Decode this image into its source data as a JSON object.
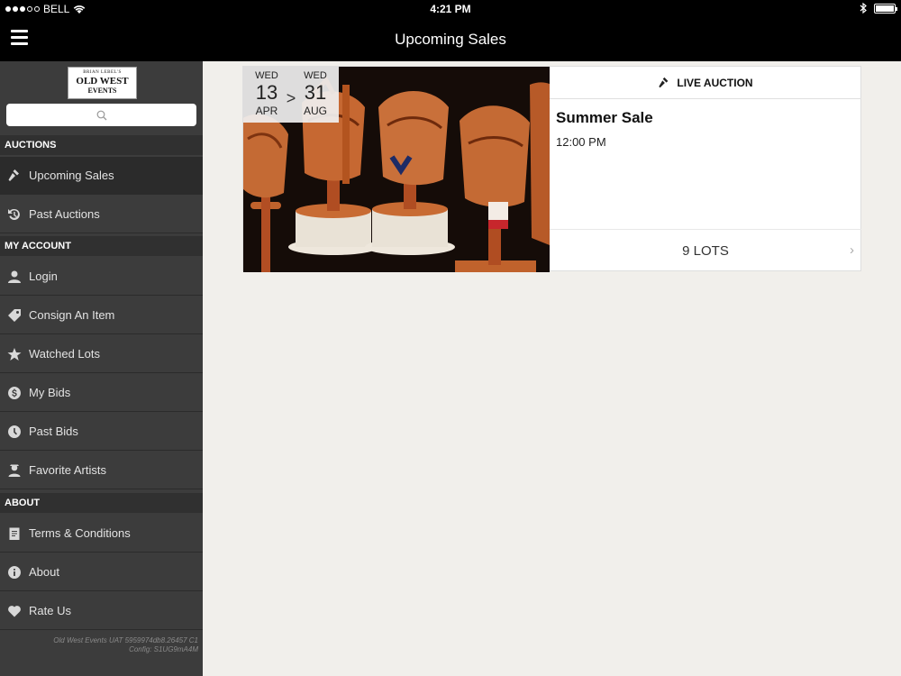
{
  "status": {
    "carrier": "BELL",
    "time": "4:21 PM",
    "battery_level": 1.0
  },
  "nav": {
    "title": "Upcoming Sales"
  },
  "sidebar": {
    "logo": {
      "line1": "BRIAN LEBEL'S",
      "line2": "OLD WEST",
      "line3": "EVENTS"
    },
    "sections": [
      {
        "header": "AUCTIONS",
        "items": [
          {
            "label": "Upcoming Sales",
            "icon": "gavel-icon",
            "active": true
          },
          {
            "label": "Past Auctions",
            "icon": "history-icon"
          }
        ]
      },
      {
        "header": "MY ACCOUNT",
        "items": [
          {
            "label": "Login",
            "icon": "user-icon"
          },
          {
            "label": "Consign An Item",
            "icon": "tag-icon"
          },
          {
            "label": "Watched Lots",
            "icon": "star-icon"
          },
          {
            "label": "My Bids",
            "icon": "dollar-icon"
          },
          {
            "label": "Past Bids",
            "icon": "clock-icon"
          },
          {
            "label": "Favorite Artists",
            "icon": "artist-icon"
          }
        ]
      },
      {
        "header": "ABOUT",
        "items": [
          {
            "label": "Terms & Conditions",
            "icon": "document-icon"
          },
          {
            "label": "About",
            "icon": "info-icon"
          },
          {
            "label": "Rate Us",
            "icon": "heart-icon"
          }
        ]
      }
    ],
    "version_line1": "Old West Events UAT 5959974db8.26457 C1",
    "version_line2": "Config: S1UG9mA4M"
  },
  "sale": {
    "start": {
      "dow": "WED",
      "day": "13",
      "month": "APR"
    },
    "end": {
      "dow": "WED",
      "day": "31",
      "month": "AUG"
    },
    "separator": ">",
    "type_label": "LIVE AUCTION",
    "title": "Summer Sale",
    "time": "12:00 PM",
    "lots_label": "9 LOTS",
    "chevron": "›"
  },
  "colors": {
    "bar_bg": "#000000",
    "sidebar_bg": "#3c3c3c",
    "main_bg": "#f1efeb",
    "accent_saddle": "#c2622d"
  }
}
